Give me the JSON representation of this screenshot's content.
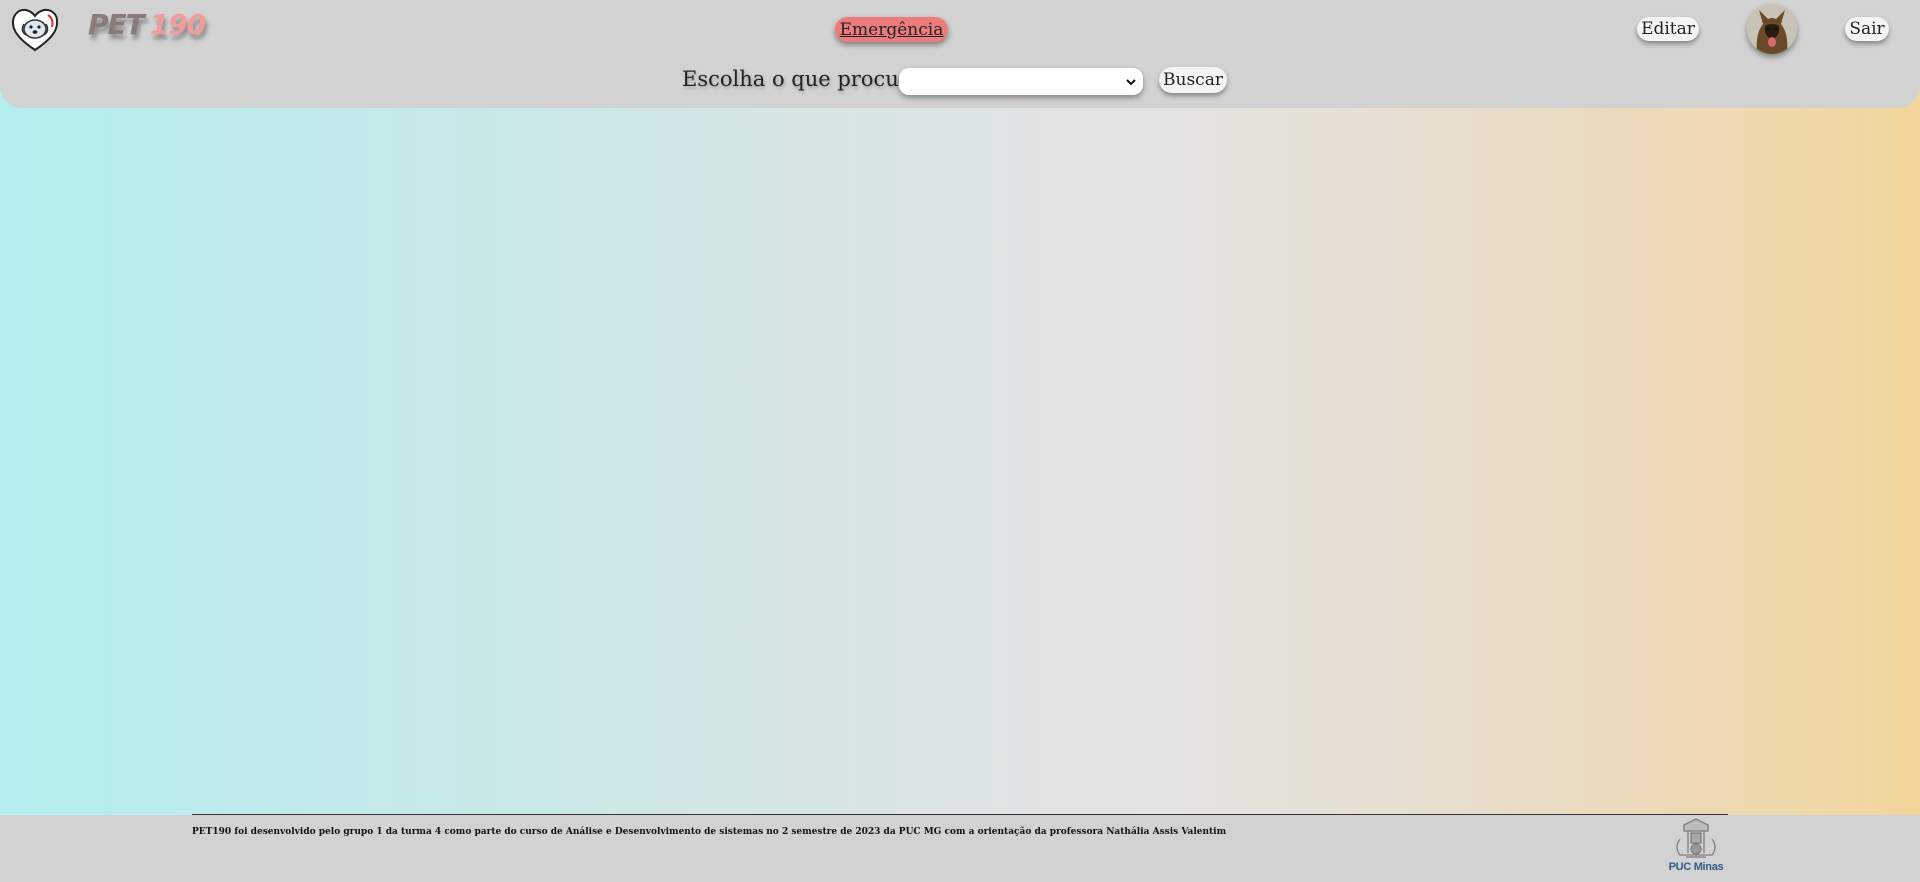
{
  "header": {
    "logo_part1": "PET",
    "logo_part2": "190",
    "emergency_label": "Emergência",
    "edit_label": "Editar",
    "logout_label": "Sair",
    "search_label": "Escolha o que procura:",
    "select_value": "",
    "search_button_label": "Buscar"
  },
  "footer": {
    "text": "PET190 foi desenvolvido pelo grupo 1 da turma 4 como parte do curso de Análise e Desenvolvimento de sistemas no 2 semestre de 2023 da PUC MG com a orientação da professora Nathália Assis Valentim",
    "partner_logo_text": "PUC Minas"
  },
  "colors": {
    "emergency": "#ec7c7c",
    "header_bg": "#d2d2d2",
    "gradient_left": "#b4eeee",
    "gradient_right": "#f2d69c"
  },
  "icons": [
    "heart-dog-logo-icon",
    "chevron-down-icon",
    "puc-crest-icon"
  ]
}
